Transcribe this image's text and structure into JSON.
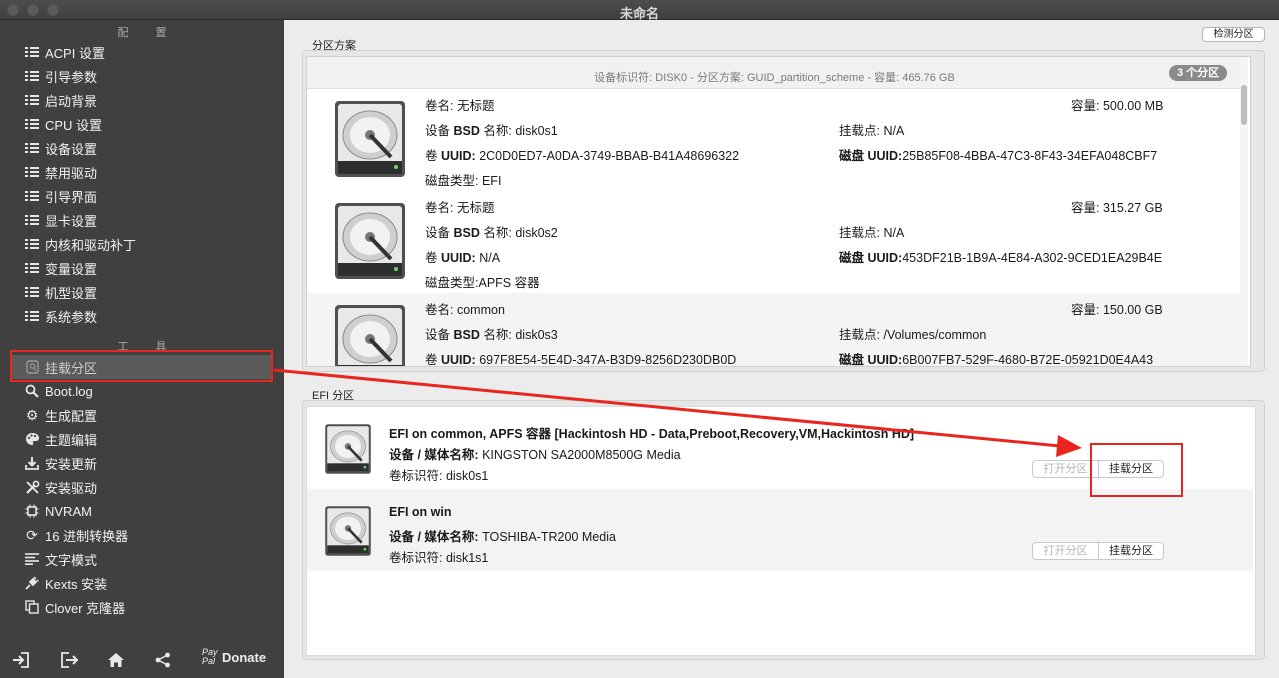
{
  "window": {
    "title": "未命名"
  },
  "sidebar": {
    "config_header": "配 置",
    "config_items": [
      {
        "label": "ACPI 设置",
        "icon": "list-icon"
      },
      {
        "label": "引导参数",
        "icon": "list-icon"
      },
      {
        "label": "启动背景",
        "icon": "list-icon"
      },
      {
        "label": "CPU 设置",
        "icon": "list-icon"
      },
      {
        "label": "设备设置",
        "icon": "list-icon"
      },
      {
        "label": "禁用驱动",
        "icon": "list-icon"
      },
      {
        "label": "引导界面",
        "icon": "list-icon"
      },
      {
        "label": "显卡设置",
        "icon": "list-icon"
      },
      {
        "label": "内核和驱动补丁",
        "icon": "list-icon"
      },
      {
        "label": "变量设置",
        "icon": "list-icon"
      },
      {
        "label": "机型设置",
        "icon": "list-icon"
      },
      {
        "label": "系统参数",
        "icon": "list-icon"
      }
    ],
    "tools_header": "工 具",
    "tool_items": [
      {
        "label": "挂载分区",
        "icon": "mount-icon"
      },
      {
        "label": "Boot.log",
        "icon": "search-icon"
      },
      {
        "label": "生成配置",
        "icon": "gear-icon"
      },
      {
        "label": "主题编辑",
        "icon": "palette-icon"
      },
      {
        "label": "安装更新",
        "icon": "download-icon"
      },
      {
        "label": "安装驱动",
        "icon": "tools-icon"
      },
      {
        "label": "NVRAM",
        "icon": "chip-icon"
      },
      {
        "label": "16 进制转换器",
        "icon": "refresh-icon"
      },
      {
        "label": "文字模式",
        "icon": "text-icon"
      },
      {
        "label": "Kexts 安装",
        "icon": "plug-icon"
      },
      {
        "label": "Clover 克隆器",
        "icon": "clone-icon"
      }
    ],
    "bottom": {
      "pay": "Pay",
      "pal": "Pal",
      "donate": "Donate"
    }
  },
  "main": {
    "detect_button": "检测分区",
    "partition_scheme": {
      "label": "分区方案",
      "info": "设备标识符: DISK0 - 分区方案: GUID_partition_scheme - 容量: 465.76 GB",
      "badge": "3 个分区",
      "rows": [
        {
          "volume_label": "卷名:",
          "volume": "无标题",
          "capacity_label": "容量:",
          "capacity": "500.00 MB",
          "bsd_label_a": "设备",
          "bsd_label_b": "BSD",
          "bsd_label_c": "名称:",
          "bsd": "disk0s1",
          "mount_label": "挂载点:",
          "mount": "N/A",
          "uuid_label_a": "卷",
          "uuid_label_b": "UUID:",
          "uuid": "2C0D0ED7-A0DA-3749-BBAB-B41A48696322",
          "disk_uuid_label_a": "磁盘",
          "disk_uuid_label_b": "UUID:",
          "disk_uuid": "25B85F08-4BBA-47C3-8F43-34EFA048CBF7",
          "type_label": "磁盘类型:",
          "type": "EFI"
        },
        {
          "volume_label": "卷名:",
          "volume": "无标题",
          "capacity_label": "容量:",
          "capacity": "315.27 GB",
          "bsd_label_a": "设备",
          "bsd_label_b": "BSD",
          "bsd_label_c": "名称:",
          "bsd": "disk0s2",
          "mount_label": "挂载点:",
          "mount": "N/A",
          "uuid_label_a": "卷",
          "uuid_label_b": "UUID:",
          "uuid": "N/A",
          "disk_uuid_label_a": "磁盘",
          "disk_uuid_label_b": "UUID:",
          "disk_uuid": "453DF21B-1B9A-4E84-A302-9CED1EA29B4E",
          "type_label": "磁盘类型:",
          "type": "APFS 容器"
        },
        {
          "volume_label": "卷名:",
          "volume": "common",
          "capacity_label": "容量:",
          "capacity": "150.00 GB",
          "bsd_label_a": "设备",
          "bsd_label_b": "BSD",
          "bsd_label_c": "名称:",
          "bsd": "disk0s3",
          "mount_label": "挂载点:",
          "mount": "/Volumes/common",
          "uuid_label_a": "卷",
          "uuid_label_b": "UUID:",
          "uuid": "697F8E54-5E4D-347A-B3D9-8256D230DB0D",
          "disk_uuid_label_a": "磁盘",
          "disk_uuid_label_b": "UUID:",
          "disk_uuid": "6B007FB7-529F-4680-B72E-05921D0E4A43",
          "type_label": "",
          "type": ""
        }
      ]
    },
    "efi": {
      "label": "EFI 分区",
      "rows": [
        {
          "title": "EFI on common, APFS 容器 [Hackintosh HD - Data,Preboot,Recovery,VM,Hackintosh HD]",
          "media_label": "设备 / 媒体名称:",
          "media": "KINGSTON SA2000M8500G Media",
          "id_label": "卷标识符:",
          "id": "disk0s1",
          "open_button": "打开分区",
          "mount_button": "挂载分区"
        },
        {
          "title": "EFI on win",
          "media_label": "设备 / 媒体名称:",
          "media": "TOSHIBA-TR200 Media",
          "id_label": "卷标识符:",
          "id": "disk1s1",
          "open_button": "打开分区",
          "mount_button": "挂载分区"
        }
      ]
    }
  },
  "colors": {
    "annotation_red": "#e8261f",
    "sidebar_bg": "#404040",
    "content_bg": "#ececec"
  }
}
